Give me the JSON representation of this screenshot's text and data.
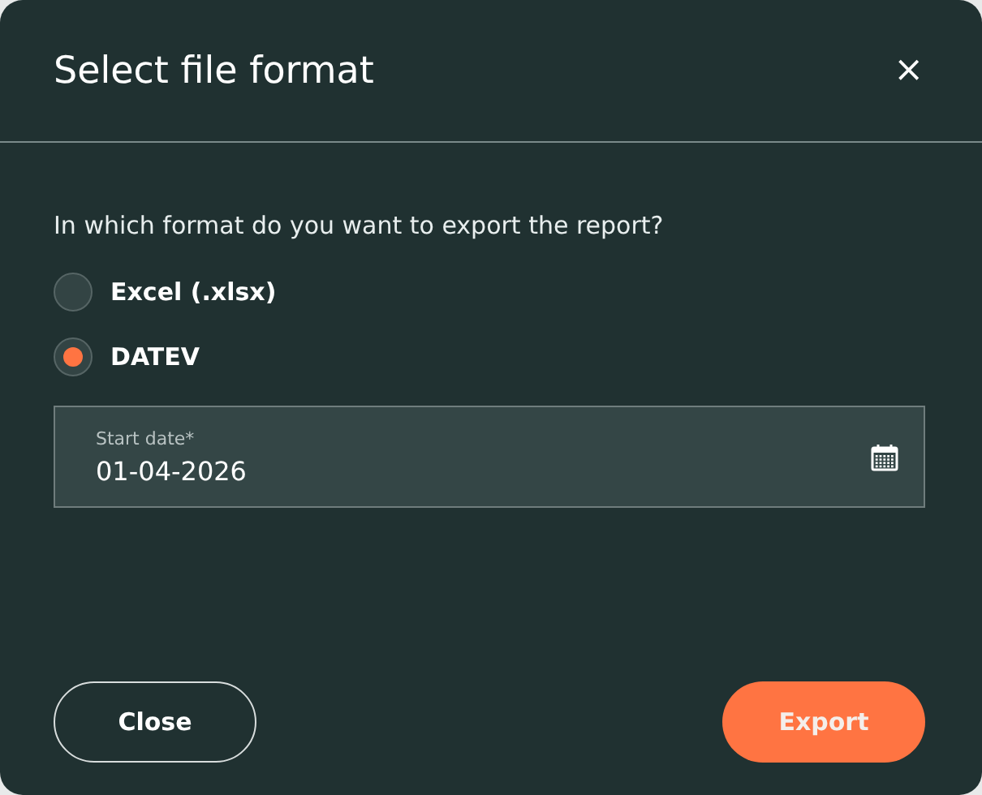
{
  "dialog": {
    "title": "Select file format",
    "close_icon": "×"
  },
  "question": "In which format do you want to export the report?",
  "options": [
    {
      "label": "Excel (.xlsx)",
      "selected": false
    },
    {
      "label": "DATEV",
      "selected": true
    }
  ],
  "date_field": {
    "label": "Start date*",
    "value": "01-04-2026"
  },
  "buttons": [
    {
      "label": "Close",
      "kind": "secondary"
    },
    {
      "label": "Export",
      "kind": "primary"
    }
  ]
}
